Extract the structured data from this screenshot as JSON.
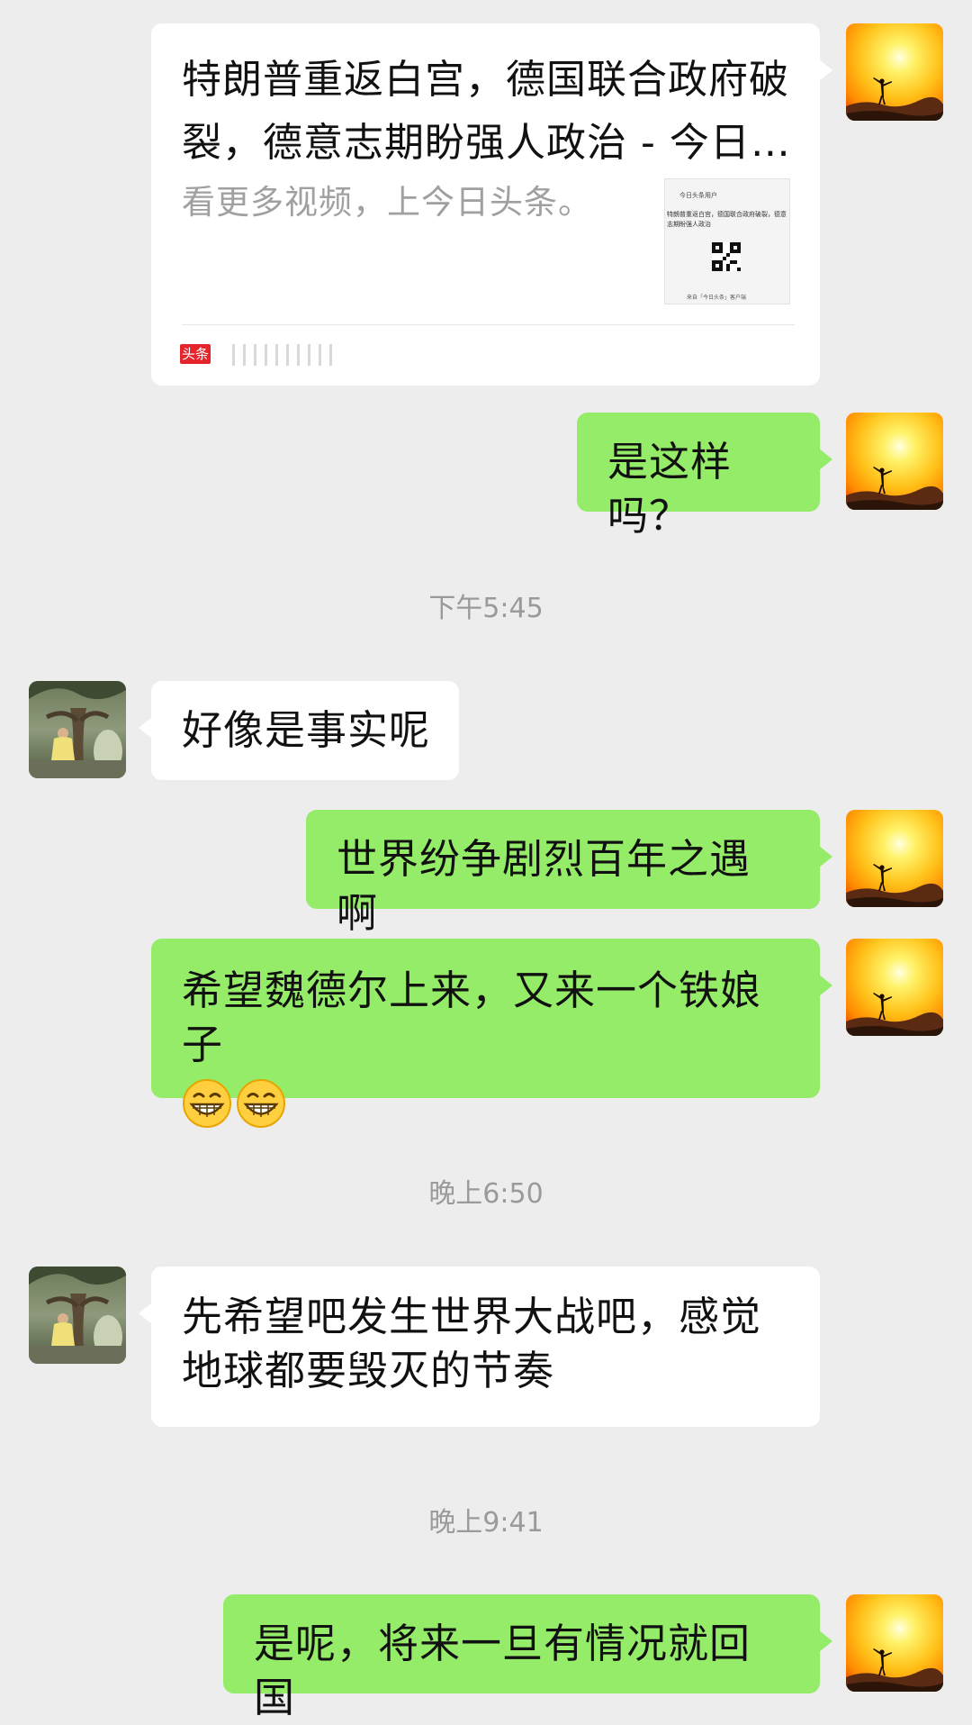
{
  "link_card": {
    "title": "特朗普重返白宫，德国联合政府破裂，德意志期盼强人政治 - 今日…",
    "description": "看更多视频，上今日头条。",
    "thumbnail": {
      "header": "今日头条用户",
      "text": "特朗普重返白宫，德国联合政府破裂，德意志期盼强人政治",
      "footer": "来自「今日头条」客户端"
    },
    "source_logo": "头条"
  },
  "messages": {
    "m1": "是这样吗？",
    "t1": "下午5:45",
    "m2": "好像是事实呢",
    "m3": "世界纷争剧烈百年之遇啊",
    "m4": "希望魏德尔上来，又来一个铁娘子",
    "t2": "晚上6:50",
    "m5": "先希望吧发生世界大战吧，感觉地球都要毁灭的节奏",
    "t3": "晚上9:41",
    "m6": "是呢，将来一旦有情况就回国"
  },
  "emoji": [
    "grinning-face-emoji",
    "grinning-face-emoji"
  ],
  "colors": {
    "background": "#ededed",
    "self_bubble": "#95ec69",
    "peer_bubble": "#ffffff",
    "timestamp": "#9a9a9a"
  }
}
